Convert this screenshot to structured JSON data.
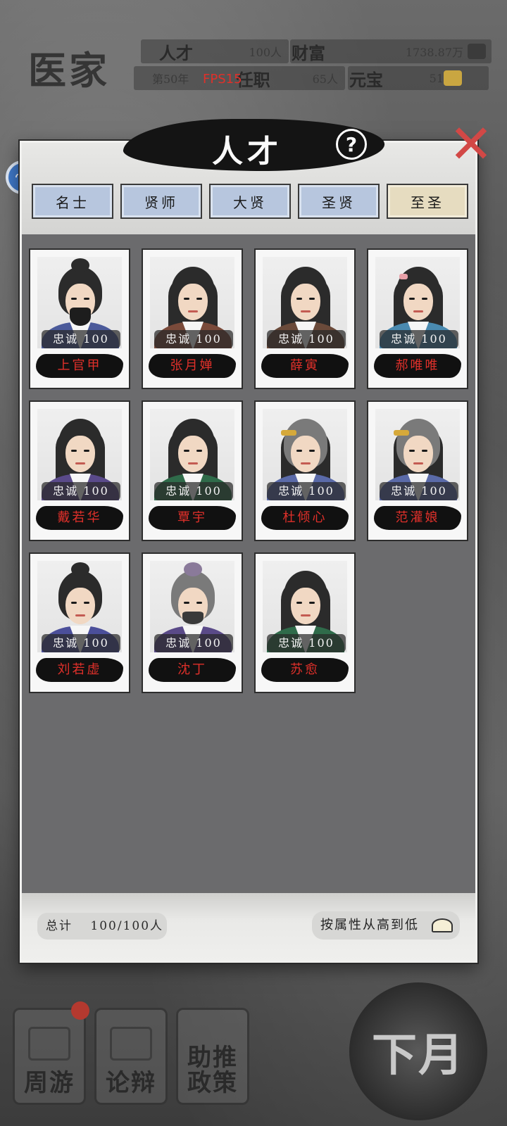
{
  "hud": {
    "school": "医家",
    "talent_label": "人才",
    "talent_value": "100人",
    "wealth_label": "财富",
    "wealth_value": "1738.87万",
    "year": "第50年",
    "fps": "FPS15",
    "office_label": "任职",
    "office_value": "65人",
    "ingot_label": "元宝",
    "ingot_value": "51"
  },
  "modal": {
    "title": "人才",
    "help_symbol": "?",
    "close_symbol": "✕",
    "tabs": [
      {
        "label": "名士",
        "active": false
      },
      {
        "label": "贤师",
        "active": false
      },
      {
        "label": "大贤",
        "active": false
      },
      {
        "label": "圣贤",
        "active": false
      },
      {
        "label": "至圣",
        "active": true
      }
    ],
    "loyalty_text": "忠诚 100",
    "talents": [
      {
        "name": "上官甲",
        "robe": "#4b5a9a",
        "style": "bun-beard"
      },
      {
        "name": "张月婵",
        "robe": "#7a4a3a",
        "style": "long"
      },
      {
        "name": "薛寅",
        "robe": "#6a4a3a",
        "style": "long"
      },
      {
        "name": "郝唯唯",
        "robe": "#4a8ab0",
        "style": "long-pin"
      },
      {
        "name": "戴若华",
        "robe": "#5a4a8a",
        "style": "long"
      },
      {
        "name": "覃宇",
        "robe": "#2f6b4a",
        "style": "long"
      },
      {
        "name": "杜倾心",
        "robe": "#5a6aa8",
        "style": "long-gold"
      },
      {
        "name": "范灌娘",
        "robe": "#5a6aa8",
        "style": "long-gold"
      },
      {
        "name": "刘若虚",
        "robe": "#4b4f9a",
        "style": "bun"
      },
      {
        "name": "沈丁",
        "robe": "#5a4a88",
        "style": "bun-beard-old"
      },
      {
        "name": "苏愈",
        "robe": "#2f6b4a",
        "style": "long"
      }
    ],
    "total_label": "总计",
    "total_value": "100/100人",
    "sort_label": "按属性从高到低"
  },
  "side_bubble": "ᴖᴖ",
  "bottom_nav": [
    {
      "label": "周游",
      "badge": true
    },
    {
      "label": "论辩",
      "badge": false
    },
    {
      "label": "助推\n政策",
      "badge": false
    }
  ],
  "next_month": "下月"
}
